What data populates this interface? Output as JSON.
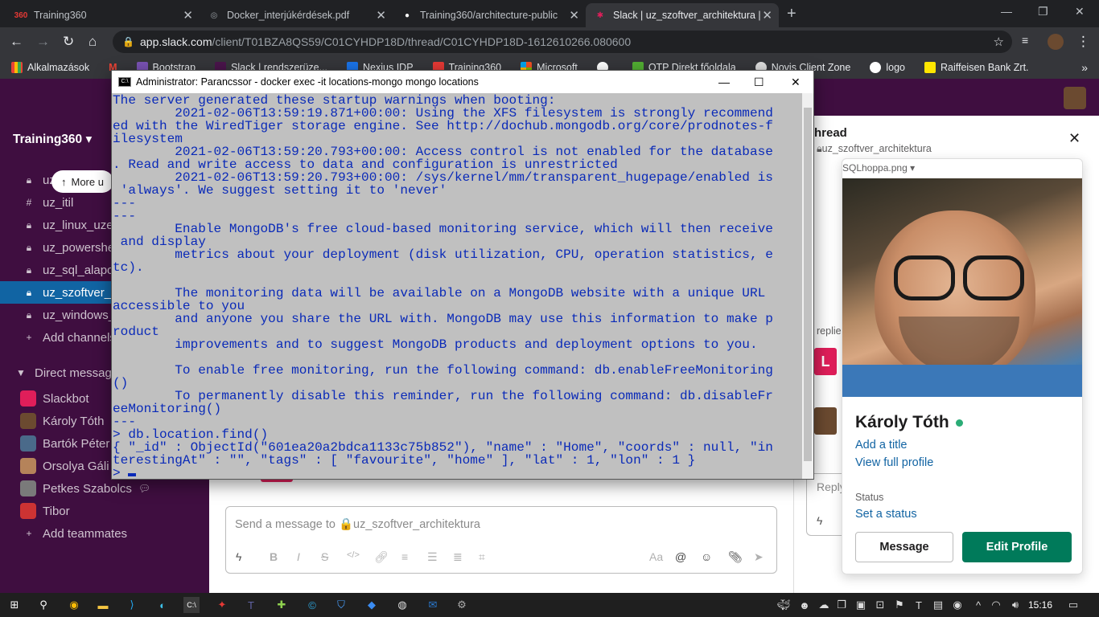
{
  "browser": {
    "tabs": [
      {
        "label": "Training360",
        "favicon": "360"
      },
      {
        "label": "Docker_interjúkérdések.pdf",
        "favicon": "globe-icon"
      },
      {
        "label": "Training360/architecture-public",
        "favicon": "github-icon"
      },
      {
        "label": "Slack | uz_szoftver_architektura |",
        "favicon": "slack-icon"
      }
    ],
    "url_host": "app.slack.com",
    "url_path": "/client/T01BZA8QS59/C01CYHDP18D/thread/C01CYHDP18D-1612610266.080600",
    "bookmarks": [
      "Alkalmazások",
      "M",
      "Bootstrap",
      "Slack | rendszerüze...",
      "Nexius IDP",
      "Training360",
      "Microsoft",
      "",
      "OTP Direkt főoldala",
      "Novis Client Zone",
      "logo",
      "Raiffeisen Bank Zrt."
    ]
  },
  "sidebar": {
    "workspace": "Training360",
    "more_unreads": "More u",
    "channels": [
      {
        "label": "uz",
        "icon": "lock-icon"
      },
      {
        "label": "uz_itil",
        "icon": "hash-icon"
      },
      {
        "label": "uz_linux_uzem",
        "icon": "lock-icon"
      },
      {
        "label": "uz_powershe",
        "icon": "lock-icon"
      },
      {
        "label": "uz_sql_alapol",
        "icon": "lock-icon"
      },
      {
        "label": "uz_szoftver_a",
        "icon": "lock-icon",
        "active": true
      },
      {
        "label": "uz_windows_",
        "icon": "lock-icon"
      }
    ],
    "add_channels": "Add channels",
    "dm_header": "Direct message",
    "dms": [
      {
        "label": "Slackbot",
        "color": "#e01e5a"
      },
      {
        "label": "Károly Tóth",
        "color": "#6b4a30"
      },
      {
        "label": "Bartók Péter",
        "color": "#4a6a8a"
      },
      {
        "label": "Orsolya Gáli",
        "color": "#b5835a"
      },
      {
        "label": "Petkes Szabolcs",
        "color": "#7a7a7a"
      },
      {
        "label": "Tibor",
        "color": "#c33"
      }
    ],
    "add_teammates": "Add teammates"
  },
  "composer": {
    "placeholder": "Send a message to 🔒uz_szoftver_architektura"
  },
  "thread": {
    "title": "hread",
    "subtitle": "uz_szoftver_architektura",
    "reply_placeholder": "Reply",
    "replies_fragment": "replie",
    "file_name": "SQLhoppa.png"
  },
  "profile": {
    "name": "Károly Tóth",
    "add_title": "Add a title",
    "view_full": "View full profile",
    "status_label": "Status",
    "set_status": "Set a status",
    "message_btn": "Message",
    "edit_btn": "Edit Profile",
    "online_color": "#2bac76"
  },
  "cmd": {
    "title": "Administrator: Parancssor - docker  exec -it locations-mongo mongo locations",
    "lines": [
      "The server generated these startup warnings when booting:",
      "        2021-02-06T13:59:19.871+00:00: Using the XFS filesystem is strongly recommend",
      "ed with the WiredTiger storage engine. See http://dochub.mongodb.org/core/prodnotes-f",
      "ilesystem",
      "        2021-02-06T13:59:20.793+00:00: Access control is not enabled for the database",
      ". Read and write access to data and configuration is unrestricted",
      "        2021-02-06T13:59:20.793+00:00: /sys/kernel/mm/transparent_hugepage/enabled is",
      " 'always'. We suggest setting it to 'never'",
      "---",
      "---",
      "        Enable MongoDB's free cloud-based monitoring service, which will then receive",
      " and display",
      "        metrics about your deployment (disk utilization, CPU, operation statistics, e",
      "tc).",
      "",
      "        The monitoring data will be available on a MongoDB website with a unique URL",
      "accessible to you",
      "        and anyone you share the URL with. MongoDB may use this information to make p",
      "roduct",
      "        improvements and to suggest MongoDB products and deployment options to you.",
      "",
      "        To enable free monitoring, run the following command: db.enableFreeMonitoring",
      "()",
      "        To permanently disable this reminder, run the following command: db.disableFr",
      "eeMonitoring()",
      "---",
      "> db.location.find()",
      "{ \"_id\" : ObjectId(\"601ea20a2bdca1133c75b852\"), \"name\" : \"Home\", \"coords\" : null, \"in",
      "terestingAt\" : \"\", \"tags\" : [ \"favourite\", \"home\" ], \"lat\" : 1, \"lon\" : 1 }"
    ],
    "prompt": "> "
  },
  "taskbar": {
    "time": "15:16"
  }
}
